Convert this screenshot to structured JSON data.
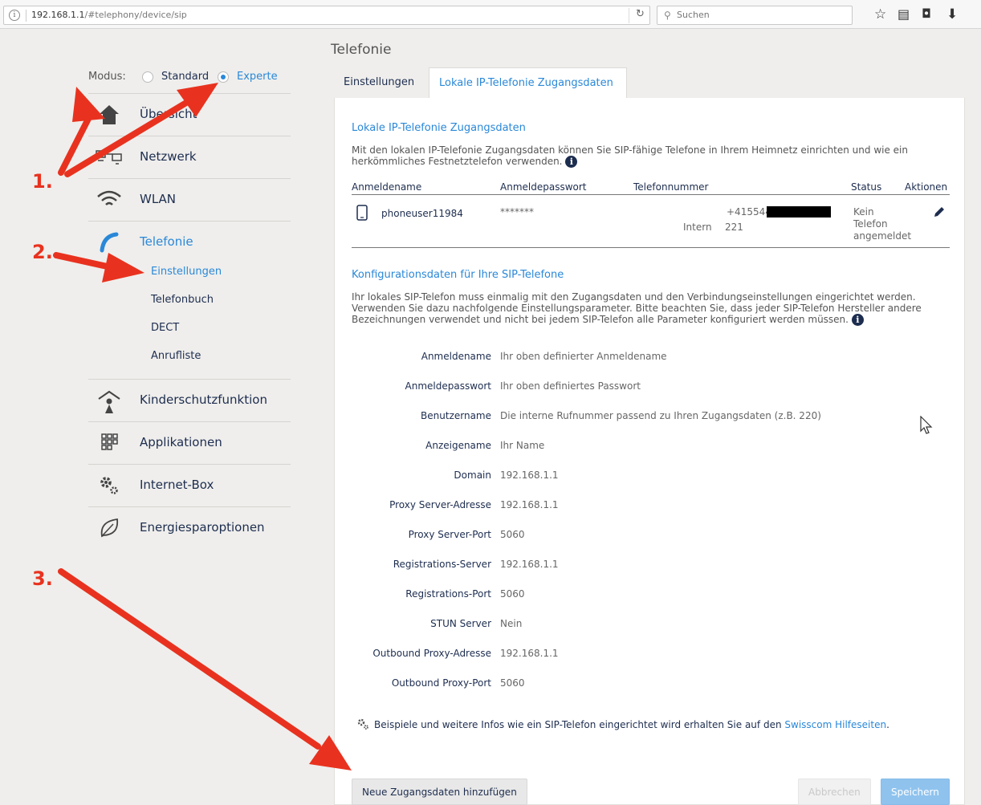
{
  "browser": {
    "url_host": "192.168.1.1",
    "url_path": "/#telephony/device/sip",
    "search_placeholder": "Suchen"
  },
  "mode": {
    "label": "Modus:",
    "options": [
      {
        "label": "Standard",
        "selected": false
      },
      {
        "label": "Experte",
        "selected": true
      }
    ]
  },
  "sidebar": {
    "items": [
      {
        "label": "Übersicht",
        "icon": "home-icon"
      },
      {
        "label": "Netzwerk",
        "icon": "network-icon"
      },
      {
        "label": "WLAN",
        "icon": "wifi-icon"
      },
      {
        "label": "Telefonie",
        "icon": "phone-icon",
        "active": true
      },
      {
        "label": "Kinderschutzfunktion",
        "icon": "child-protection-icon"
      },
      {
        "label": "Applikationen",
        "icon": "apps-grid-icon"
      },
      {
        "label": "Internet-Box",
        "icon": "gears-icon"
      },
      {
        "label": "Energiesparoptionen",
        "icon": "leaf-icon"
      }
    ],
    "subitems": [
      {
        "label": "Einstellungen",
        "active": true
      },
      {
        "label": "Telefonbuch"
      },
      {
        "label": "DECT"
      },
      {
        "label": "Anrufliste"
      }
    ]
  },
  "page": {
    "title": "Telefonie",
    "tabs": [
      {
        "label": "Einstellungen",
        "active": false
      },
      {
        "label": "Lokale IP-Telefonie Zugangsdaten",
        "active": true
      }
    ]
  },
  "credentials": {
    "title": "Lokale IP-Telefonie Zugangsdaten",
    "description": "Mit den lokalen IP-Telefonie Zugangsdaten können Sie SIP-fähige Telefone in Ihrem Heimnetz einrichten und wie ein herkömmliches Festnetztelefon verwenden.",
    "columns": [
      "Anmeldename",
      "Anmeldepasswort",
      "Telefonnummer",
      "Status",
      "Aktionen"
    ],
    "row": {
      "username": "phoneuser11984",
      "password": "*******",
      "phone_number": "+415544",
      "intern_label": "Intern",
      "intern_number": "221",
      "status_line1": "Kein",
      "status_line2": "Telefon",
      "status_line3": "angemeldet"
    }
  },
  "config": {
    "title": "Konfigurationsdaten für Ihre SIP-Telefone",
    "description": "Ihr lokales SIP-Telefon muss einmalig mit den Zugangsdaten und den Verbindungseinstellungen eingerichtet werden. Verwenden Sie dazu nachfolgende Einstellungsparameter. Bitte beachten Sie, dass jeder SIP-Telefon Hersteller andere Bezeichnungen verwendet und nicht bei jedem SIP-Telefon alle Parameter konfiguriert werden müssen.",
    "rows": [
      {
        "label": "Anmeldename",
        "value": "Ihr oben definierter Anmeldename"
      },
      {
        "label": "Anmeldepasswort",
        "value": "Ihr oben definiertes Passwort"
      },
      {
        "label": "Benutzername",
        "value": "Die interne Rufnummer passend zu Ihren Zugangsdaten (z.B. 220)"
      },
      {
        "label": "Anzeigename",
        "value": "Ihr Name"
      },
      {
        "label": "Domain",
        "value": "192.168.1.1"
      },
      {
        "label": "Proxy Server-Adresse",
        "value": "192.168.1.1"
      },
      {
        "label": "Proxy Server-Port",
        "value": "5060"
      },
      {
        "label": "Registrations-Server",
        "value": "192.168.1.1"
      },
      {
        "label": "Registrations-Port",
        "value": "5060"
      },
      {
        "label": "STUN Server",
        "value": "Nein"
      },
      {
        "label": "Outbound Proxy-Adresse",
        "value": "192.168.1.1"
      },
      {
        "label": "Outbound Proxy-Port",
        "value": "5060"
      }
    ]
  },
  "footnote": {
    "text": "Beispiele und weitere Infos wie ein SIP-Telefon eingerichtet wird erhalten Sie auf den",
    "link": "Swisscom Hilfeseiten",
    "end": "."
  },
  "buttons": {
    "add": "Neue Zugangsdaten hinzufügen",
    "cancel": "Abbrechen",
    "save": "Speichern"
  },
  "annotations": [
    "1.",
    "2.",
    "3."
  ],
  "colors": {
    "accent": "#2a88d8",
    "text": "#1d2d4f",
    "arrow": "#e8321f"
  }
}
